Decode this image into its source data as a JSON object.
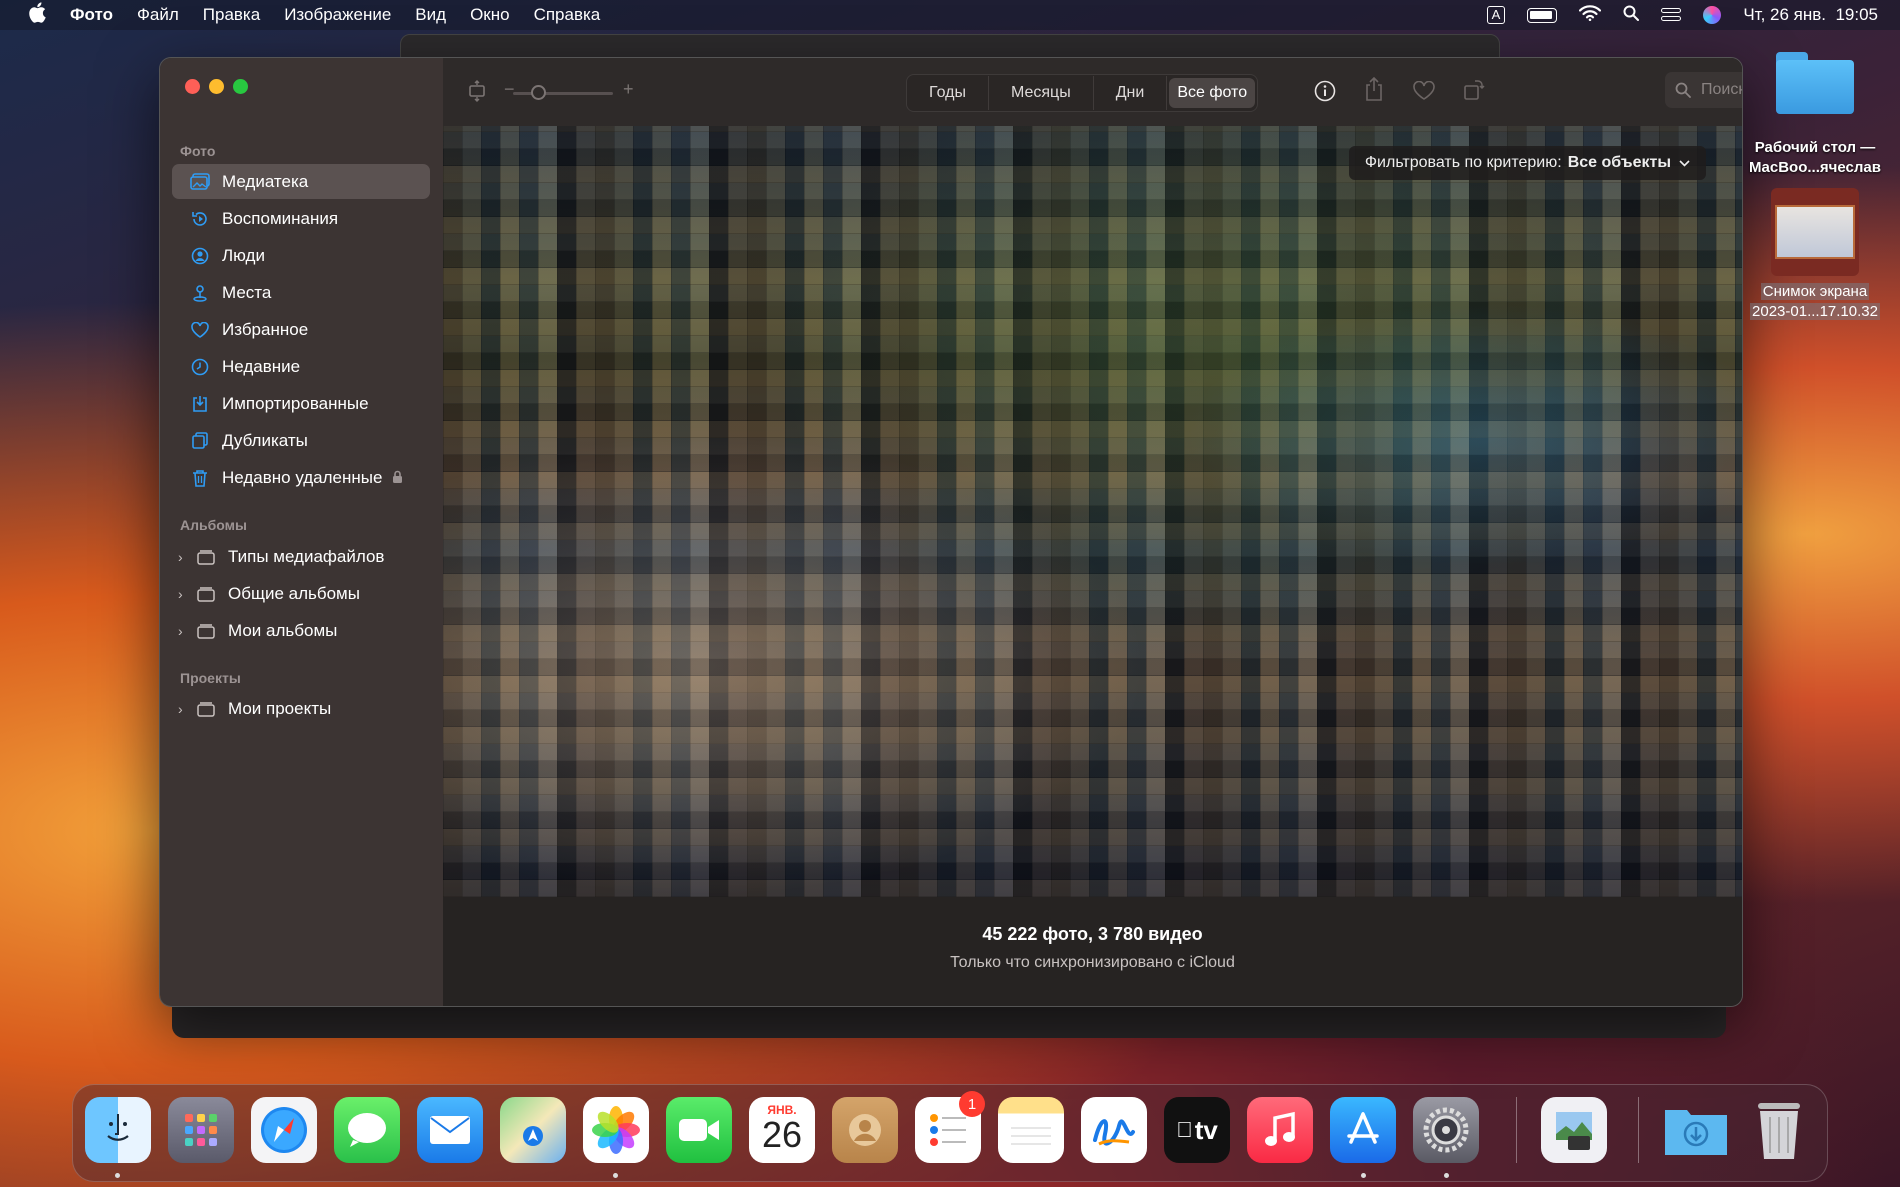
{
  "menubar": {
    "app_name": "Фото",
    "items": [
      "Файл",
      "Правка",
      "Изображение",
      "Вид",
      "Окно",
      "Справка"
    ],
    "input_source": "A",
    "clock": "Чт, 26 янв.  19:05"
  },
  "sidebar": {
    "section_photos": "Фото",
    "items": [
      {
        "label": "Медиатека",
        "icon": "library-icon"
      },
      {
        "label": "Воспоминания",
        "icon": "memories-icon"
      },
      {
        "label": "Люди",
        "icon": "people-icon"
      },
      {
        "label": "Места",
        "icon": "places-icon"
      },
      {
        "label": "Избранное",
        "icon": "heart-icon"
      },
      {
        "label": "Недавние",
        "icon": "clock-icon"
      },
      {
        "label": "Импортированные",
        "icon": "import-icon"
      },
      {
        "label": "Дубликаты",
        "icon": "duplicates-icon"
      },
      {
        "label": "Недавно удаленные",
        "icon": "trash-icon"
      }
    ],
    "section_albums": "Альбомы",
    "albums": [
      "Типы медиафайлов",
      "Общие альбомы",
      "Мои альбомы"
    ],
    "section_projects": "Проекты",
    "projects": [
      "Мои проекты"
    ]
  },
  "toolbar": {
    "segments": [
      "Годы",
      "Месяцы",
      "Дни",
      "Все фото"
    ],
    "active_segment": "Все фото",
    "zoom_minus": "−",
    "zoom_plus": "+",
    "search_placeholder": "Поиск"
  },
  "filter": {
    "label": "Фильтровать по критерию:",
    "value": "Все объекты"
  },
  "footer": {
    "summary": "45 222 фото, 3 780 видео",
    "sync_status": "Только что синхронизировано с iCloud"
  },
  "desktop": {
    "folder_label_1": "Рабочий стол —",
    "folder_label_2": "MacBoo...ячеслав",
    "screenshot_label_1": "Снимок экрана",
    "screenshot_label_2": "2023-01...17.10.32"
  },
  "dock": {
    "calendar_month": "ЯНВ.",
    "calendar_day": "26",
    "reminders_badge": "1",
    "tv_label": "tv"
  },
  "colors": {
    "accent": "#2f9cf4",
    "sidebar_bg": "#3c3433",
    "content_bg": "#262322"
  }
}
